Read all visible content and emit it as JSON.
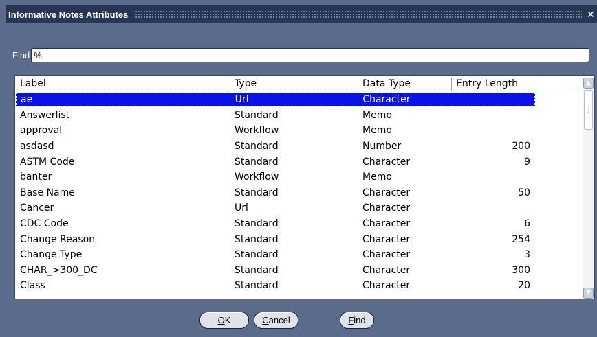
{
  "window": {
    "title": "Informative Notes Attributes",
    "close_glyph": "✕"
  },
  "find": {
    "label": "Find",
    "value": "%"
  },
  "table": {
    "headers": [
      "Label",
      "Type",
      "Data Type",
      "Entry Length"
    ],
    "rows": [
      {
        "label": "ae",
        "type": "Url",
        "data_type": "Character",
        "entry_length": "",
        "selected": true
      },
      {
        "label": "Answerlist",
        "type": "Standard",
        "data_type": "Memo",
        "entry_length": ""
      },
      {
        "label": "approval",
        "type": "Workflow",
        "data_type": "Memo",
        "entry_length": ""
      },
      {
        "label": "asdasd",
        "type": "Standard",
        "data_type": "Number",
        "entry_length": "200"
      },
      {
        "label": "ASTM Code",
        "type": "Standard",
        "data_type": "Character",
        "entry_length": "9"
      },
      {
        "label": "banter",
        "type": "Workflow",
        "data_type": "Memo",
        "entry_length": ""
      },
      {
        "label": "Base Name",
        "type": "Standard",
        "data_type": "Character",
        "entry_length": "50"
      },
      {
        "label": "Cancer",
        "type": "Url",
        "data_type": "Character",
        "entry_length": ""
      },
      {
        "label": "CDC Code",
        "type": "Standard",
        "data_type": "Character",
        "entry_length": "6"
      },
      {
        "label": "Change Reason",
        "type": "Standard",
        "data_type": "Character",
        "entry_length": "254"
      },
      {
        "label": "Change Type",
        "type": "Standard",
        "data_type": "Character",
        "entry_length": "3"
      },
      {
        "label": "CHAR_>300_DC",
        "type": "Standard",
        "data_type": "Character",
        "entry_length": "300"
      },
      {
        "label": "Class",
        "type": "Standard",
        "data_type": "Character",
        "entry_length": "20"
      }
    ]
  },
  "buttons": {
    "ok": {
      "mnemonic": "O",
      "rest": "K"
    },
    "cancel": {
      "mnemonic": "C",
      "rest": "ancel"
    },
    "find": {
      "mnemonic": "F",
      "rest": "ind"
    }
  },
  "colors": {
    "background": "#5b6b8b",
    "titlebar": "#283656",
    "selection": "#0b12e8"
  }
}
